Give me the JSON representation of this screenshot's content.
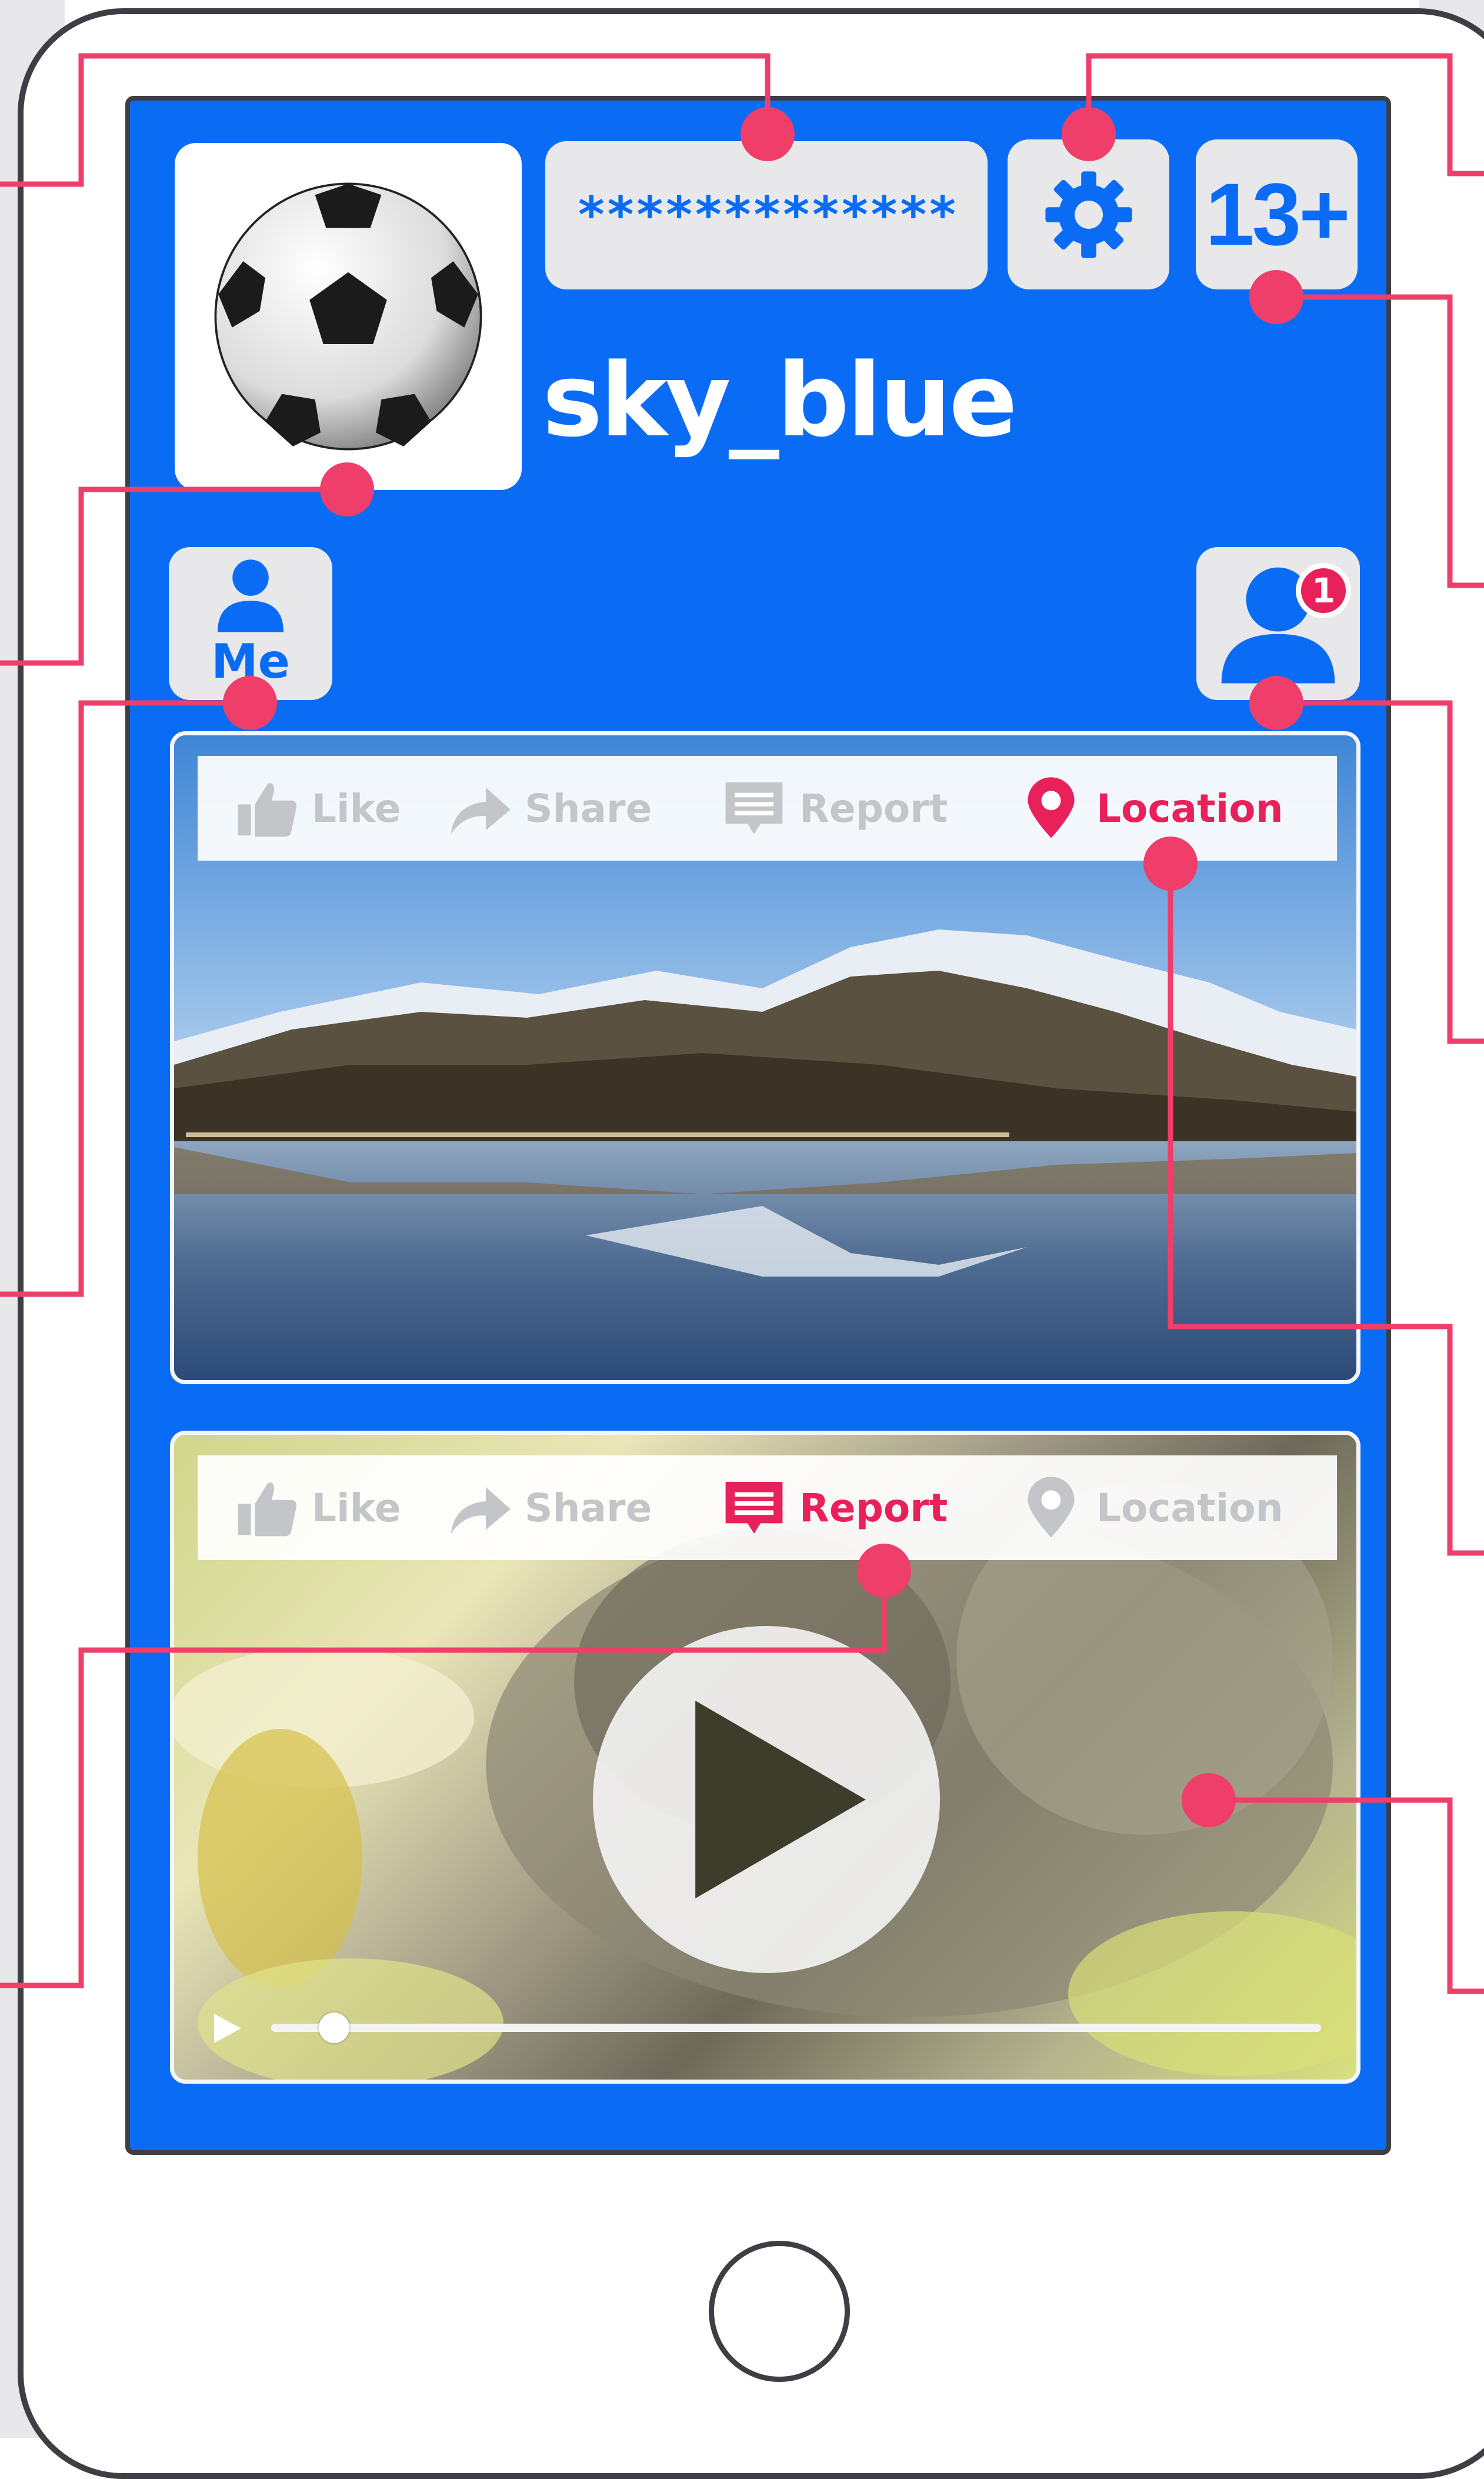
{
  "profile": {
    "password_mask": "*************",
    "username": "sky_blue",
    "age_rating": "13+",
    "avatar_icon": "soccer-ball-icon"
  },
  "nav": {
    "me_label": "Me",
    "friends_icon": "friends-icon",
    "friend_notification_count": "1",
    "settings_icon": "gear-icon"
  },
  "posts": [
    {
      "media": "mountain-lake-photo",
      "actions": [
        {
          "label": "Like",
          "icon": "thumbs-up-icon",
          "active": false
        },
        {
          "label": "Share",
          "icon": "share-arrow-icon",
          "active": false
        },
        {
          "label": "Report",
          "icon": "speech-bubble-icon",
          "active": false
        },
        {
          "label": "Location",
          "icon": "location-pin-icon",
          "active": true
        }
      ]
    },
    {
      "media": "cat-video",
      "progress": 0.06,
      "actions": [
        {
          "label": "Like",
          "icon": "thumbs-up-icon",
          "active": false
        },
        {
          "label": "Share",
          "icon": "share-arrow-icon",
          "active": false
        },
        {
          "label": "Report",
          "icon": "speech-bubble-icon",
          "active": true
        },
        {
          "label": "Location",
          "icon": "location-pin-icon",
          "active": false
        }
      ]
    }
  ],
  "colors": {
    "screen_bg": "#0a6cf5",
    "accent": "#e8215b",
    "tile_bg": "#e8e8ea",
    "inactive": "#c3c5c9",
    "frame": "#3e3e44"
  }
}
